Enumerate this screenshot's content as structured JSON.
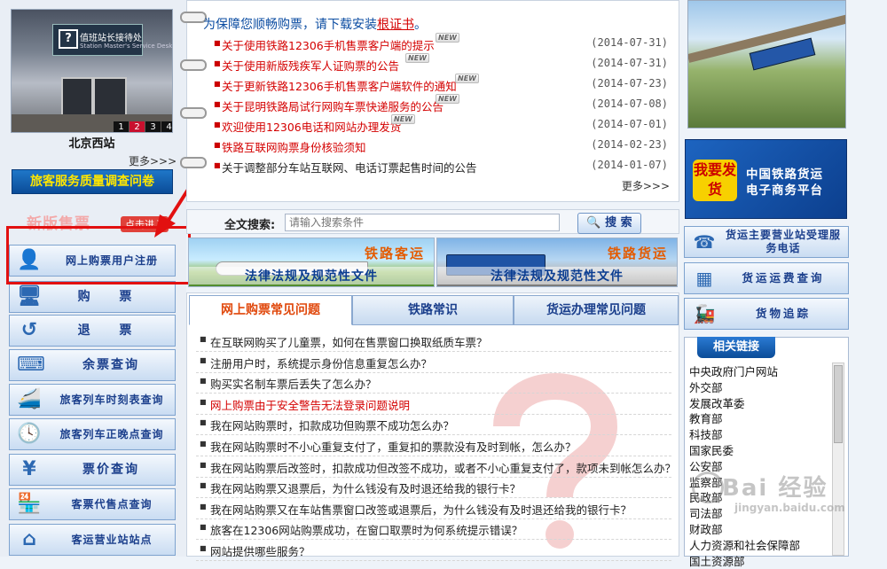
{
  "left": {
    "station_photo": {
      "sign_text": "值班站长接待处",
      "sign_sub": "Station Master's Service Desk",
      "pages": [
        "1",
        "2",
        "3",
        "4"
      ],
      "active_page": "2"
    },
    "station_name": "北京西站",
    "more": "更多>>>",
    "survey_button": "旅客服务质量调查问卷",
    "new_sale_title": "新版售票",
    "new_sale_tag": "点击进入",
    "menu": [
      {
        "label": "网上购票用户注册",
        "icon": "user-icon"
      },
      {
        "label": "购 票",
        "icon": "computer-icon"
      },
      {
        "label": "退 票",
        "icon": "return-arrow-icon"
      },
      {
        "label": "余票查询",
        "icon": "keyboard-icon"
      },
      {
        "label": "旅客列车时刻表查询",
        "icon": "train-icon"
      },
      {
        "label": "旅客列车正晚点查询",
        "icon": "clock-icon"
      },
      {
        "label": "票价查询",
        "icon": "money-icon"
      },
      {
        "label": "客票代售点查询",
        "icon": "shop-icon"
      },
      {
        "label": "客运营业站站点",
        "icon": "house-icon"
      }
    ]
  },
  "notice": {
    "intro_prefix": "为保障您顺畅购票，请下载安装",
    "intro_link": "根证书",
    "intro_suffix": "。",
    "new_badge": "NEW",
    "items": [
      {
        "title": "关于使用铁路12306手机售票客户端的提示",
        "date": "(2014-07-31)",
        "isnew": true,
        "red": true
      },
      {
        "title": "关于使用新版残疾军人证购票的公告",
        "date": "(2014-07-31)",
        "isnew": true,
        "red": true
      },
      {
        "title": "关于更新铁路12306手机售票客户端软件的通知",
        "date": "(2014-07-23)",
        "isnew": true,
        "red": true
      },
      {
        "title": "关于昆明铁路局试行网购车票快递服务的公告",
        "date": "(2014-07-08)",
        "isnew": true,
        "red": true
      },
      {
        "title": "欢迎使用12306电话和网站办理发货",
        "date": "(2014-07-01)",
        "isnew": true,
        "red": true
      },
      {
        "title": "铁路互联网购票身份核验须知",
        "date": "(2014-02-23)",
        "isnew": false,
        "red": true
      },
      {
        "title": "关于调整部分车站互联网、电话订票起售时间的公告",
        "date": "(2014-01-07)",
        "isnew": false,
        "red": false
      }
    ],
    "more": "更多>>>"
  },
  "search": {
    "label": "全文搜索:",
    "placeholder": "请输入搜索条件",
    "button": "搜 索"
  },
  "banners": {
    "passenger": {
      "tag": "铁路客运",
      "sub": "法律法规及规范性文件"
    },
    "freight": {
      "tag": "铁路货运",
      "sub": "法律法规及规范性文件"
    }
  },
  "faq": {
    "tabs": [
      "网上购票常见问题",
      "铁路常识",
      "货运办理常见问题"
    ],
    "active_tab": 0,
    "items": [
      {
        "text": "在互联网购买了儿童票，如何在售票窗口换取纸质车票？",
        "red": false
      },
      {
        "text": "注册用户时，系统提示身份信息重复怎么办？",
        "red": false
      },
      {
        "text": "购买实名制车票后丢失了怎么办？",
        "red": false
      },
      {
        "text": "网上购票由于安全警告无法登录问题说明",
        "red": true
      },
      {
        "text": "我在网站购票时，扣款成功但购票不成功怎么办？",
        "red": false
      },
      {
        "text": "我在网站购票时不小心重复支付了，重复扣的票款没有及时到帐，怎么办？",
        "red": false
      },
      {
        "text": "我在网站购票后改签时，扣款成功但改签不成功，或者不小心重复支付了，款项未到帐怎么办？",
        "red": false
      },
      {
        "text": "我在网站购票又退票后，为什么钱没有及时退还给我的银行卡？",
        "red": false
      },
      {
        "text": "我在网站购票又在车站售票窗口改签或退票后，为什么钱没有及时退还给我的银行卡？",
        "red": false
      },
      {
        "text": "旅客在12306网站购票成功，在窗口取票时为何系统提示错误？",
        "red": false
      },
      {
        "text": "网站提供哪些服务？",
        "red": false
      }
    ]
  },
  "right": {
    "freight_platform": {
      "badge": "我要发货",
      "title_line1": "中国铁路货运",
      "title_line2": "电子商务平台"
    },
    "buttons": [
      {
        "label": "货运主要营业站受理服务电话",
        "icon": "phone-icon"
      },
      {
        "label": "货运运费查询",
        "icon": "calculator-icon"
      },
      {
        "label": "货物追踪",
        "icon": "locomotive-icon"
      }
    ],
    "links_title": "相关链接",
    "links": [
      "中央政府门户网站",
      "外交部",
      "发展改革委",
      "教育部",
      "科技部",
      "国家民委",
      "公安部",
      "监察部",
      "民政部",
      "司法部",
      "财政部",
      "人力资源和社会保障部",
      "国土资源部"
    ],
    "watermark": {
      "text": "Bai 经验",
      "url": "jingyan.baidu.com"
    }
  }
}
